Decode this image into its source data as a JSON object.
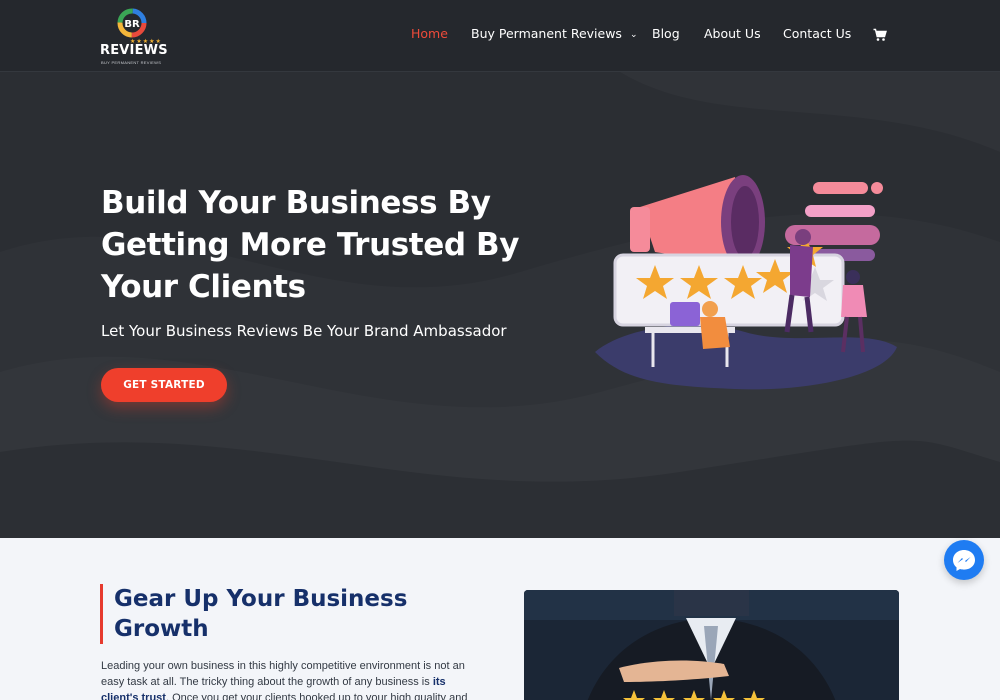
{
  "header": {
    "logo": {
      "wordmark": "REVIEWS",
      "stars": "★★★★★",
      "tagline": "BUY PERMANENT REVIEWS"
    },
    "nav": {
      "home": "Home",
      "buy_reviews": "Buy Permanent Reviews",
      "blog": "Blog",
      "about": "About Us",
      "contact": "Contact Us"
    },
    "active_color": "#ef4b3a",
    "cart_icon": "shopping-cart-icon"
  },
  "hero": {
    "title": "Build Your Business By Getting More Trusted By Your Clients",
    "subtitle": "Let Your Business Reviews Be Your Brand Ambassador",
    "cta_label": "GET STARTED",
    "cta_color": "#ef3f2c",
    "background": "#2b2e33"
  },
  "growth": {
    "title": "Gear Up Your Business Growth",
    "para_before": "Leading your own business in this highly competitive environment is not an easy task at all. The tricky thing about the growth of any business is ",
    "para_bold": "its client's trust",
    "para_after": ". Once you get your clients hooked up to your high quality and",
    "accent_color": "#e63a2e",
    "title_color": "#16306a"
  },
  "messenger_icon": "messenger-icon"
}
